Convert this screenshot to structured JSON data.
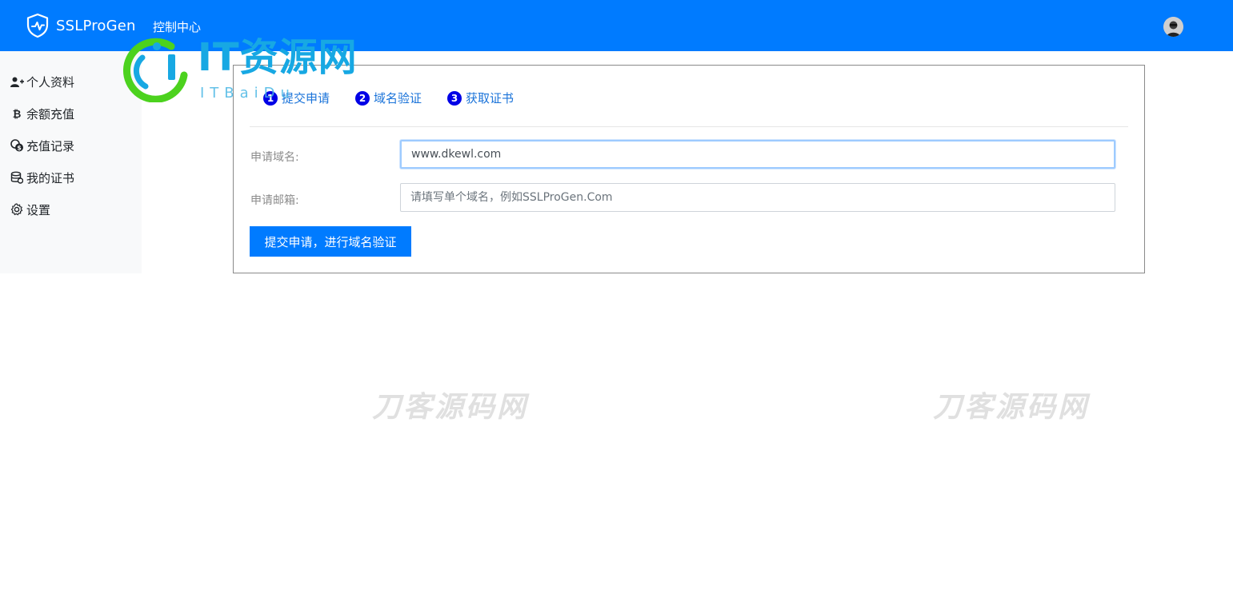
{
  "brand": {
    "name": "SSLProGen",
    "icon": "shield-pulse-icon"
  },
  "nav": {
    "console": "控制中心"
  },
  "user": {
    "avatar": "user-avatar"
  },
  "sidebar": {
    "items": [
      {
        "label": "个人资料",
        "icon": "user-plus-icon"
      },
      {
        "label": "余额充值",
        "icon": "bitcoin-icon"
      },
      {
        "label": "充值记录",
        "icon": "coins-icon"
      },
      {
        "label": "我的证书",
        "icon": "database-icon"
      },
      {
        "label": "设置",
        "icon": "gear-icon"
      }
    ]
  },
  "steps": [
    {
      "num": "1",
      "label": "提交申请"
    },
    {
      "num": "2",
      "label": "域名验证"
    },
    {
      "num": "3",
      "label": "获取证书"
    }
  ],
  "form": {
    "domain_label": "申请域名:",
    "domain_value": "www.dkewl.com",
    "email_label": "申请邮箱:",
    "email_placeholder": "请填写单个域名，例如SSLProGen.Com",
    "submit_label": "提交申请，进行域名验证"
  },
  "watermarks": {
    "logo_main": "IT资源网",
    "logo_sub": "ITBaiDu",
    "text_left": "刀客源码网",
    "text_right": "刀客源码网"
  },
  "colors": {
    "primary": "#007bff",
    "step_badge": "#0000e6",
    "sidebar_bg": "#f8f9fa"
  }
}
